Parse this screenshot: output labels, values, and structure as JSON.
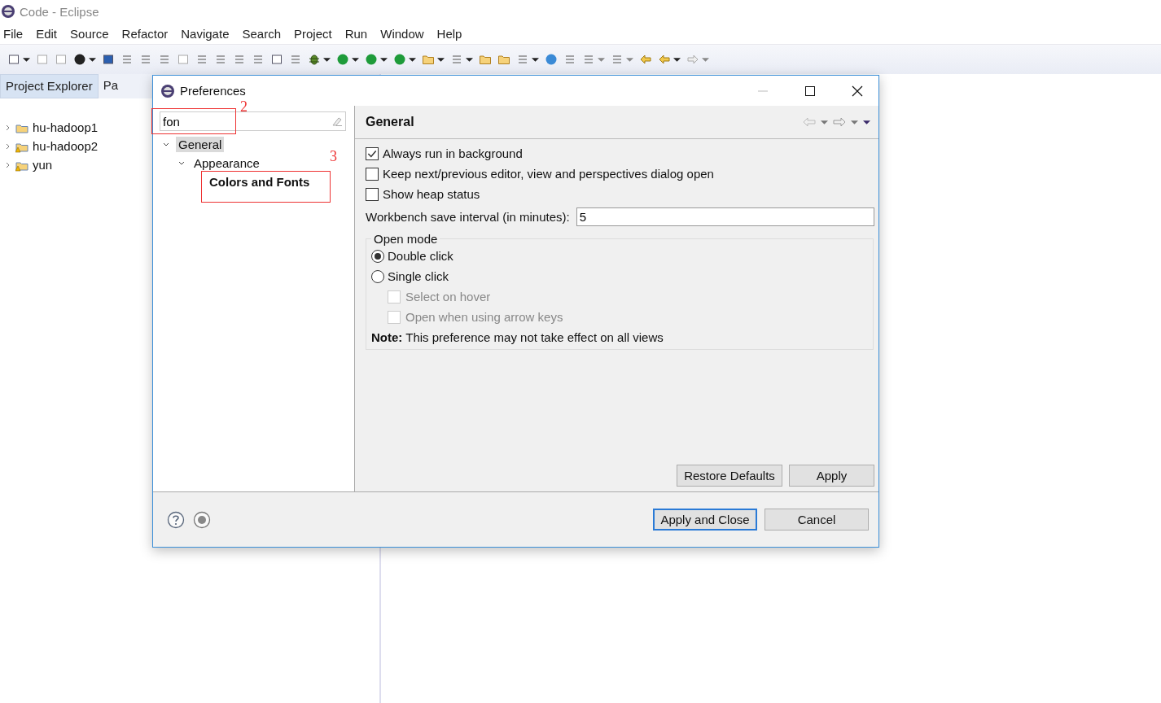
{
  "window": {
    "title": "Code - Eclipse"
  },
  "menu": [
    "File",
    "Edit",
    "Source",
    "Refactor",
    "Navigate",
    "Search",
    "Project",
    "Run",
    "Window",
    "Help"
  ],
  "view_tabs": [
    {
      "label": "Project Explorer",
      "selected": true
    },
    {
      "label": "Pa",
      "selected": false
    }
  ],
  "projects": [
    {
      "name": "hu-hadoop1",
      "expanded": false,
      "warning": false
    },
    {
      "name": "hu-hadoop2",
      "expanded": false,
      "warning": true
    },
    {
      "name": "yun",
      "expanded": false,
      "warning": true
    }
  ],
  "dialog": {
    "title": "Preferences",
    "filter": {
      "value": "fon"
    },
    "tree": [
      {
        "label": "General",
        "selected": true,
        "matched": false,
        "expanded": true,
        "children": [
          {
            "label": "Appearance",
            "selected": false,
            "matched": false,
            "expanded": true,
            "children": [
              {
                "label": "Colors and Fonts",
                "selected": false,
                "matched": true
              }
            ]
          }
        ]
      }
    ],
    "page_title": "General",
    "checkboxes": [
      {
        "label": "Always run in background",
        "checked": true
      },
      {
        "label": "Keep next/previous editor, view and perspectives dialog open",
        "checked": false
      },
      {
        "label": "Show heap status",
        "checked": false
      }
    ],
    "save_interval": {
      "label": "Workbench save interval (in minutes):",
      "value": "5"
    },
    "open_mode": {
      "title": "Open mode",
      "options": [
        {
          "kind": "radio",
          "label": "Double click",
          "selected": true,
          "disabled": false
        },
        {
          "kind": "radio",
          "label": "Single click",
          "selected": false,
          "disabled": false
        },
        {
          "kind": "checkbox",
          "label": "Select on hover",
          "checked": false,
          "disabled": true
        },
        {
          "kind": "checkbox",
          "label": "Open when using arrow keys",
          "checked": false,
          "disabled": true
        }
      ],
      "note": "**Note:** This preference may not take effect on all views"
    },
    "page_buttons": [
      "Restore Defaults",
      "Apply"
    ],
    "footer_buttons": [
      {
        "label": "Apply and Close",
        "default": true
      },
      {
        "label": "Cancel",
        "default": false
      }
    ]
  },
  "annotations": [
    {
      "label": "2"
    },
    {
      "label": "3"
    }
  ]
}
